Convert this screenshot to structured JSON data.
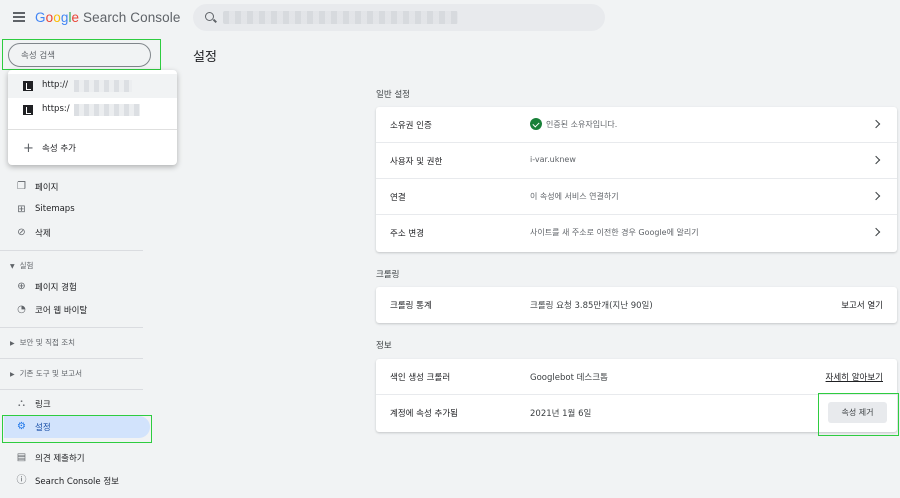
{
  "header": {
    "logo_google": [
      "G",
      "o",
      "o",
      "g",
      "l",
      "e"
    ],
    "logo_product": "Search Console",
    "search_placeholder": ""
  },
  "sidebar": {
    "property_search_placeholder": "속성 검색",
    "dropdown": {
      "properties": [
        {
          "prefix": "http://"
        },
        {
          "prefix": "https:/"
        }
      ],
      "add_property": "속성 추가"
    },
    "items_top": [
      {
        "label": "페이지",
        "icon": "page-icon"
      },
      {
        "label": "Sitemaps",
        "icon": "sitemap-icon"
      },
      {
        "label": "삭제",
        "icon": "eye-off-icon"
      }
    ],
    "group_experience": "실험",
    "items_experience": [
      {
        "label": "페이지 경험",
        "icon": "plus-circle-icon"
      },
      {
        "label": "코어 웹 바이탈",
        "icon": "speedometer-icon"
      }
    ],
    "group_security": "보안 및 직접 조치",
    "group_legacy": "기존 도구 및 보고서",
    "items_bottom": [
      {
        "label": "링크",
        "icon": "links-icon"
      },
      {
        "label": "설정",
        "icon": "gear-icon"
      },
      {
        "label": "의견 제출하기",
        "icon": "feedback-icon"
      },
      {
        "label": "Search Console 정보",
        "icon": "info-icon"
      }
    ]
  },
  "main": {
    "title": "설정",
    "general": {
      "title": "일반 설정",
      "rows": [
        {
          "label": "소유권 인증",
          "value": "인증된 소유자입니다."
        },
        {
          "label": "사용자 및 권한",
          "value": "i-var.uknew"
        },
        {
          "label": "연결",
          "value": "이 속성에 서비스 연결하기"
        },
        {
          "label": "주소 변경",
          "value": "사이트를 새 주소로 이전한 경우 Google에 알리기"
        }
      ]
    },
    "crawling": {
      "title": "크롤링",
      "rows": [
        {
          "label": "크롤링 통계",
          "value": "크롤링 요청 3.85만개(지난 90일)",
          "action": "보고서 열기"
        }
      ]
    },
    "about": {
      "title": "정보",
      "rows": [
        {
          "label": "색인 생성 크롤러",
          "value": "Googlebot 데스크톱",
          "action": "자세히 알아보기"
        },
        {
          "label": "계정에 속성 추가됨",
          "value": "2021년 1월 6일",
          "action": "속성 제거"
        }
      ]
    }
  },
  "colors": {
    "accent": "#1a73e8",
    "active_bg": "#d2e3fc",
    "success": "#188038",
    "highlight_box": "#2ecc40"
  }
}
